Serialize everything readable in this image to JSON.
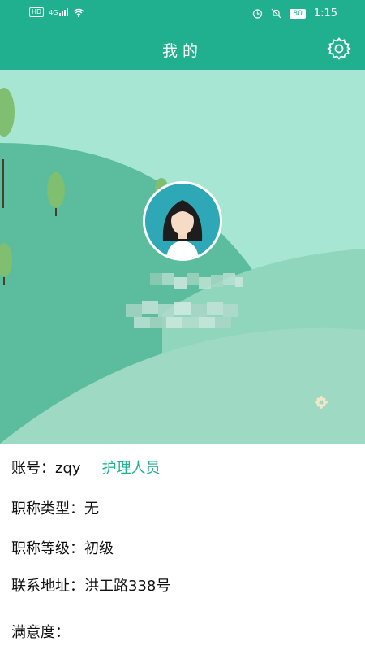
{
  "status_bar": {
    "left_icons": [
      "hd-icon",
      "4g-signal-icon",
      "wifi-icon"
    ],
    "hd_label": "HD",
    "network_label": "4G",
    "right_icons": [
      "alarm-icon",
      "mute-icon"
    ],
    "battery": "80",
    "time": "1:15"
  },
  "header": {
    "title": "我的",
    "settings_icon": "gear-icon"
  },
  "profile": {
    "avatar_icon": "female-avatar-icon"
  },
  "info": {
    "account_label": "账号：",
    "account_value": "zqy",
    "role": "护理人员",
    "title_type_label": "职称类型：",
    "title_type_value": "无",
    "title_level_label": "职称等级：",
    "title_level_value": "初级",
    "address_label": "联系地址：",
    "address_value": "洪工路338号",
    "satisfaction_label": "满意度："
  },
  "colors": {
    "primary": "#20b08f",
    "hero_bg": "#a8e6d4",
    "hill_dark": "#5bbd9d",
    "hill_light": "#8fd6bd",
    "avatar_bg": "#2ea8b6"
  }
}
